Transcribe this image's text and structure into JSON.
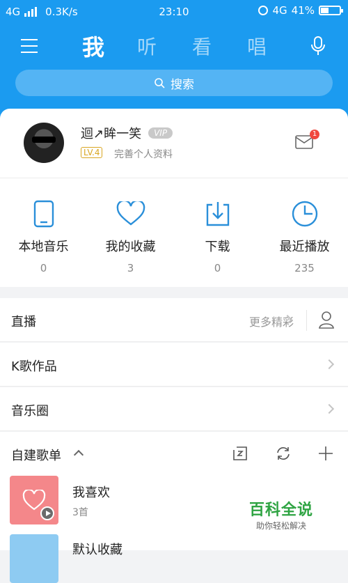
{
  "status_bar": {
    "network_left": "4G",
    "speed": "0.3K/s",
    "time": "23:10",
    "network_right": "4G",
    "battery": "41%",
    "battery_level": 0.41
  },
  "nav": {
    "tabs": [
      {
        "label": "我",
        "active": true
      },
      {
        "label": "听",
        "active": false
      },
      {
        "label": "看",
        "active": false
      },
      {
        "label": "唱",
        "active": false
      }
    ]
  },
  "search": {
    "placeholder": "搜索"
  },
  "profile": {
    "name": "迴↗眸一笑",
    "vip": "VIP",
    "level": "LV.4",
    "complete_profile": "完善个人资料",
    "mail_badge": "1"
  },
  "quick_actions": [
    {
      "label": "本地音乐",
      "count": "0",
      "icon": "phone-icon"
    },
    {
      "label": "我的收藏",
      "count": "3",
      "icon": "heart-icon"
    },
    {
      "label": "下载",
      "count": "0",
      "icon": "download-icon"
    },
    {
      "label": "最近播放",
      "count": "235",
      "icon": "clock-icon"
    }
  ],
  "list": {
    "live": {
      "label": "直播",
      "more": "更多精彩"
    },
    "k_songs": {
      "label": "K歌作品"
    },
    "music_circle": {
      "label": "音乐圈"
    }
  },
  "playlists": {
    "header": "自建歌单",
    "items": [
      {
        "title": "我喜欢",
        "subtitle": "3首"
      },
      {
        "title": "默认收藏",
        "subtitle": ""
      }
    ]
  },
  "watermark": {
    "title": "百科全说",
    "subtitle": "助你轻松解决"
  },
  "colors": {
    "accent": "#1b9bf0",
    "icon_blue": "#2a8fd9",
    "badge_red": "#f0483e",
    "level_gold": "#d9a521",
    "watermark_green": "#2fa443"
  }
}
